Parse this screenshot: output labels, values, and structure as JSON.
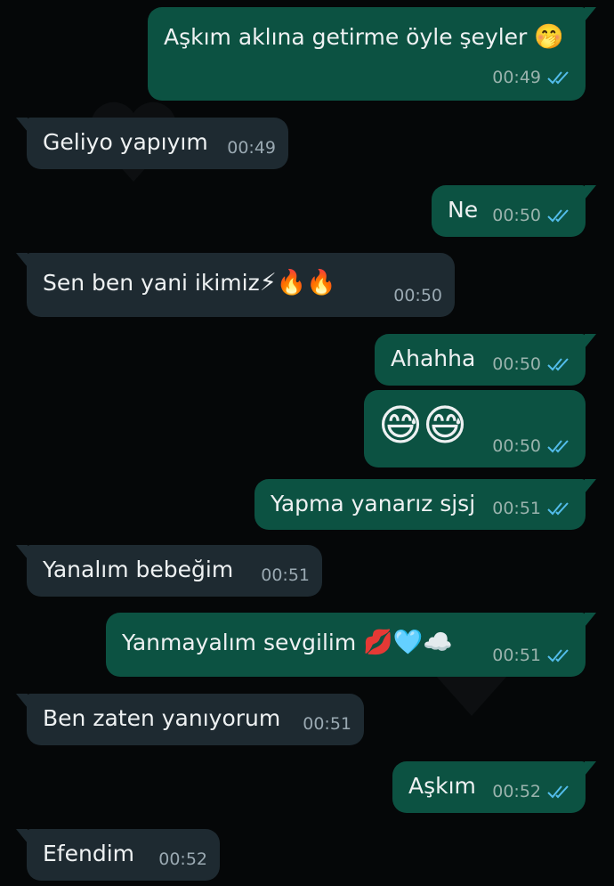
{
  "colors": {
    "outgoing_bubble": "#0c5242",
    "incoming_bubble": "#1e2a31",
    "background": "#050708",
    "read_ticks": "#53bdeb"
  },
  "messages": [
    {
      "direction": "outgoing",
      "text": "Aşkım aklına getirme öyle şeyler",
      "emoji": "🤭",
      "time": "00:49",
      "status": "read"
    },
    {
      "direction": "incoming",
      "text": "Geliyo yapıyım",
      "time": "00:49"
    },
    {
      "direction": "outgoing",
      "text": "Ne",
      "time": "00:50",
      "status": "read"
    },
    {
      "direction": "incoming",
      "text": "Sen ben yani ikimiz",
      "emoji": "⚡🔥🔥",
      "time": "00:50"
    },
    {
      "direction": "outgoing",
      "text": "Ahahha",
      "time": "00:50",
      "status": "read"
    },
    {
      "direction": "outgoing",
      "text": "",
      "emoji": "😅😅",
      "time": "00:50",
      "status": "read"
    },
    {
      "direction": "outgoing",
      "text": "Yapma yanarız sjsj",
      "time": "00:51",
      "status": "read"
    },
    {
      "direction": "incoming",
      "text": "Yanalım bebeğim",
      "time": "00:51"
    },
    {
      "direction": "outgoing",
      "text": "Yanmayalım sevgilim",
      "emoji": "💋🩵☁️",
      "time": "00:51",
      "status": "read"
    },
    {
      "direction": "incoming",
      "text": "Ben zaten yanıyorum",
      "time": "00:51"
    },
    {
      "direction": "outgoing",
      "text": "Aşkım",
      "time": "00:52",
      "status": "read"
    },
    {
      "direction": "incoming",
      "text": "Efendim",
      "time": "00:52"
    }
  ]
}
